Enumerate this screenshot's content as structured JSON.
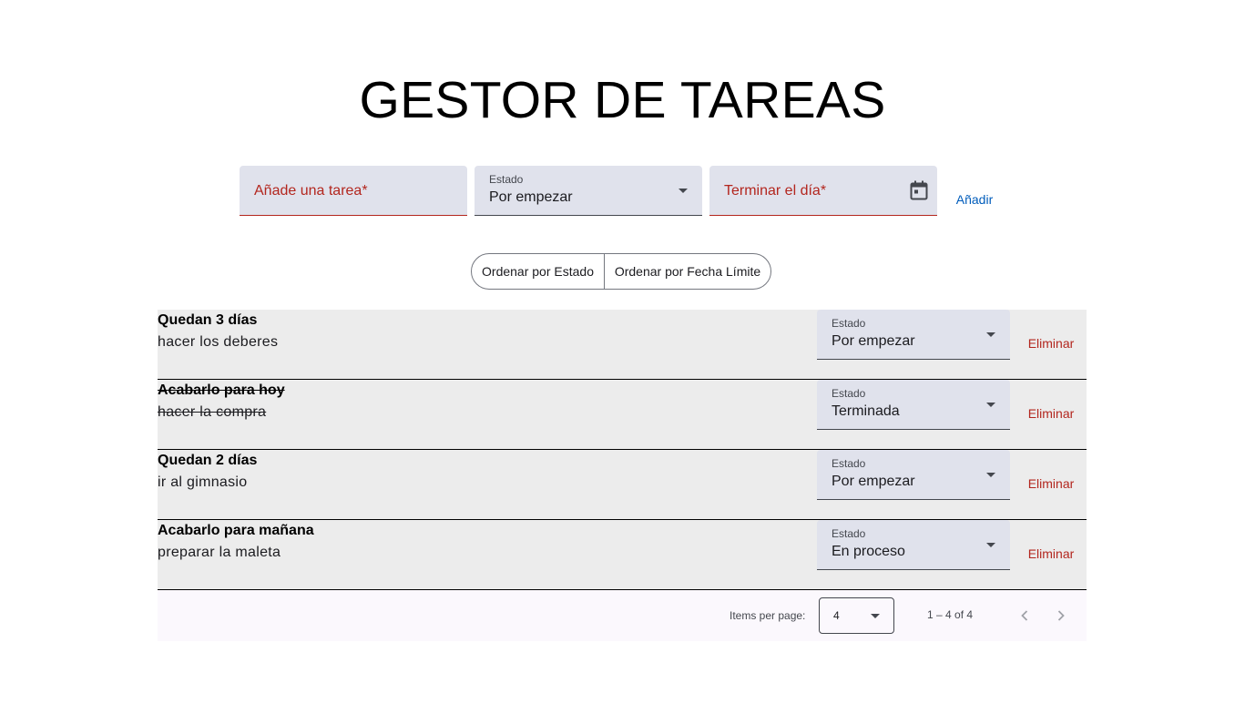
{
  "title": "GESTOR DE TAREAS",
  "form": {
    "task_placeholder": "Añade una tarea*",
    "state_label": "Estado",
    "state_value": "Por empezar",
    "date_placeholder": "Terminar el día*",
    "add_label": "Añadir"
  },
  "sort": {
    "by_state": "Ordenar por Estado",
    "by_date": "Ordenar por Fecha Límite"
  },
  "tasks": [
    {
      "when": "Quedan 3 días",
      "name": "hacer los deberes",
      "state_label": "Estado",
      "state": "Por empezar",
      "delete_label": "Eliminar",
      "done": false
    },
    {
      "when": "Acabarlo para hoy",
      "name": "hacer la compra",
      "state_label": "Estado",
      "state": "Terminada",
      "delete_label": "Eliminar",
      "done": true
    },
    {
      "when": "Quedan 2 días",
      "name": "ir al gimnasio",
      "state_label": "Estado",
      "state": "Por empezar",
      "delete_label": "Eliminar",
      "done": false
    },
    {
      "when": "Acabarlo para mañana",
      "name": "preparar la maleta",
      "state_label": "Estado",
      "state": "En proceso",
      "delete_label": "Eliminar",
      "done": false
    }
  ],
  "paginator": {
    "items_per_page_label": "Items per page:",
    "items_per_page": "4",
    "range": "1 – 4 of 4"
  },
  "colors": {
    "error": "#b3261e",
    "primary": "#005cbb",
    "field_bg": "#e0e2ec",
    "row_bg": "#ececec"
  },
  "icons": {
    "date_picker": "calendar-icon",
    "prev": "chevron-left-icon",
    "next": "chevron-right-icon"
  }
}
